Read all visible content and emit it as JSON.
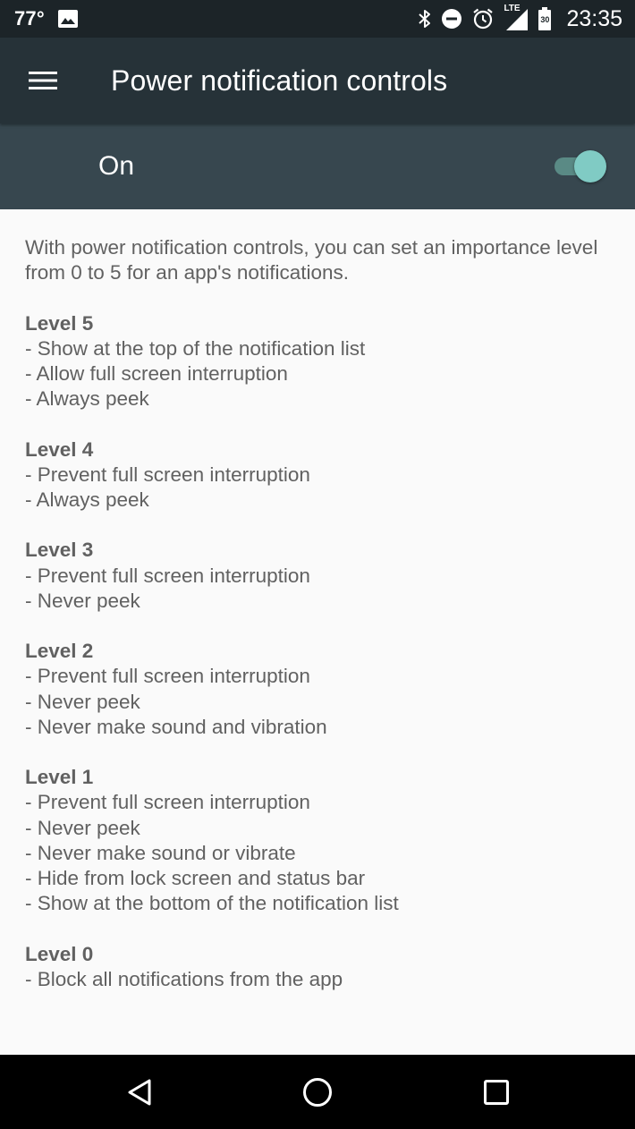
{
  "status_bar": {
    "temperature": "77°",
    "time": "23:35",
    "network": "LTE",
    "battery": "30",
    "icons": [
      "image-icon",
      "bluetooth-icon",
      "do-not-disturb-icon",
      "alarm-icon",
      "signal-icon",
      "battery-icon"
    ]
  },
  "app_bar": {
    "title": "Power notification controls",
    "menu_icon": "menu-icon"
  },
  "master_switch": {
    "label": "On",
    "checked": true,
    "accent_color": "#80cbc4"
  },
  "content": {
    "intro": "With power notification controls, you can set an importance level from 0 to 5 for an app's notifications.",
    "levels": [
      {
        "title": "Level 5",
        "items": [
          "- Show at the top of the notification list",
          "- Allow full screen interruption",
          "- Always peek"
        ]
      },
      {
        "title": "Level 4",
        "items": [
          "- Prevent full screen interruption",
          "- Always peek"
        ]
      },
      {
        "title": "Level 3",
        "items": [
          "- Prevent full screen interruption",
          "- Never peek"
        ]
      },
      {
        "title": "Level 2",
        "items": [
          "- Prevent full screen interruption",
          "- Never peek",
          "- Never make sound and vibration"
        ]
      },
      {
        "title": "Level 1",
        "items": [
          "- Prevent full screen interruption",
          "- Never peek",
          "- Never make sound or vibrate",
          "- Hide from lock screen and status bar",
          "- Show at the bottom of the notification list"
        ]
      },
      {
        "title": "Level 0",
        "items": [
          "- Block all notifications from the app"
        ]
      }
    ]
  },
  "nav_bar": {
    "icons": [
      "back-icon",
      "home-icon",
      "recents-icon"
    ]
  },
  "colors": {
    "status_bar": "#1c2428",
    "app_bar": "#263238",
    "switch_bar": "#37474f",
    "background": "#fafafa",
    "text": "#616161"
  }
}
